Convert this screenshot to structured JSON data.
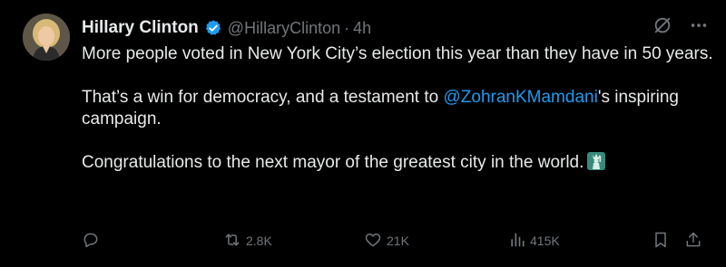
{
  "author": {
    "name": "Hillary Clinton",
    "handle": "@HillaryClinton",
    "separator": "·",
    "time": "4h",
    "verified": true
  },
  "tweet": {
    "line1": "More people voted in New York City’s election this year than they have in 50 years.",
    "line2_before": "That’s a win for democracy, and a testament to ",
    "line2_mention": "@ZohranKMamdani",
    "line2_after": "'s inspiring campaign.",
    "line3": "Congratulations to the next mayor of the greatest city in the world."
  },
  "actions": {
    "reply_count": "",
    "retweet_count": "2.8K",
    "like_count": "21K",
    "view_count": "415K"
  },
  "icons": {
    "avatar": "avatar-photo",
    "verified": "verified-badge-icon",
    "grok": "grok-icon",
    "more": "more-icon",
    "reply": "reply-icon",
    "retweet": "retweet-icon",
    "like": "heart-icon",
    "views": "views-icon",
    "bookmark": "bookmark-icon",
    "share": "share-icon",
    "emoji": "statue-of-liberty-emoji"
  },
  "colors": {
    "background": "#000000",
    "text": "#e7e9ea",
    "muted": "#71767b",
    "link": "#1d9bf0",
    "verified": "#1d9bf0"
  }
}
